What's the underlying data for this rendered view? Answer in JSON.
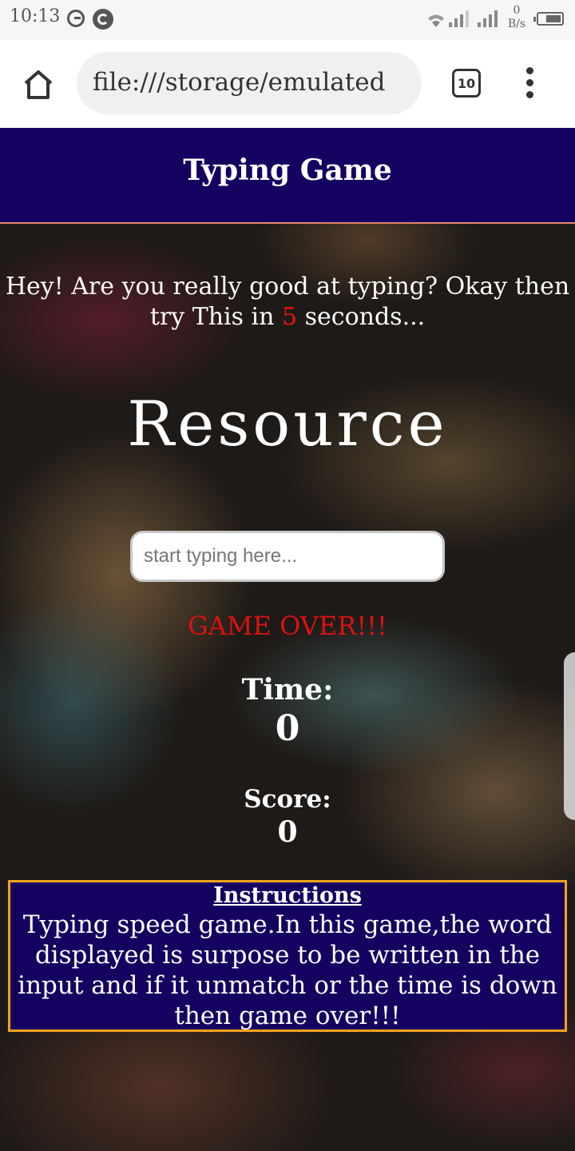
{
  "status_bar": {
    "time": "10:13",
    "net_speed_value": "0",
    "net_speed_unit": "B/s"
  },
  "browser": {
    "url": "file:///storage/emulated",
    "tab_count": "10"
  },
  "header": {
    "title": "Typing Game"
  },
  "game": {
    "intro_part1": "Hey! Are you really good at typing? Okay then try This in ",
    "seconds": "5",
    "intro_part2": " seconds...",
    "current_word": "Resource",
    "input_placeholder": "start typing here...",
    "status_message": "GAME OVER!!!",
    "time_label": "Time:",
    "time_value": "0",
    "score_label": "Score:",
    "score_value": "0"
  },
  "instructions": {
    "title": "Instructions",
    "body": "Typing speed game.In this game,the word displayed is surpose to be written in the input and if it unmatch or the time is down then game over!!!"
  },
  "colors": {
    "header_bg": "#150260",
    "accent_red": "#ee1111",
    "instructions_border": "#f5a21c"
  }
}
